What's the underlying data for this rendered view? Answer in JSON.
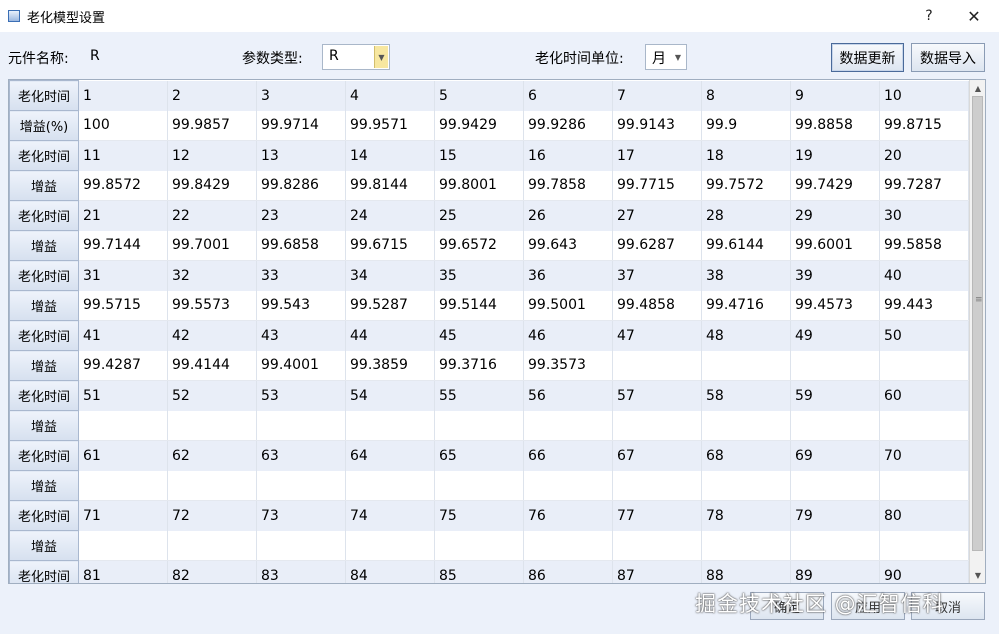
{
  "window": {
    "title": "老化模型设置",
    "help": "?",
    "close": "✕"
  },
  "toolbar": {
    "component_label": "元件名称:",
    "component_value": "R",
    "param_type_label": "参数类型:",
    "param_type_value": "R",
    "time_unit_label": "老化时间单位:",
    "time_unit_value": "月",
    "update_button": "数据更新",
    "import_button": "数据导入"
  },
  "grid": {
    "row_header_time": "老化时间",
    "rows": [
      {
        "time_label": "老化时间",
        "gain_label": "增益(%)",
        "times": [
          "1",
          "2",
          "3",
          "4",
          "5",
          "6",
          "7",
          "8",
          "9",
          "10"
        ],
        "gains": [
          "100",
          "99.9857",
          "99.9714",
          "99.9571",
          "99.9429",
          "99.9286",
          "99.9143",
          "99.9",
          "99.8858",
          "99.8715"
        ]
      },
      {
        "time_label": "老化时间",
        "gain_label": "增益",
        "times": [
          "11",
          "12",
          "13",
          "14",
          "15",
          "16",
          "17",
          "18",
          "19",
          "20"
        ],
        "gains": [
          "99.8572",
          "99.8429",
          "99.8286",
          "99.8144",
          "99.8001",
          "99.7858",
          "99.7715",
          "99.7572",
          "99.7429",
          "99.7287"
        ]
      },
      {
        "time_label": "老化时间",
        "gain_label": "增益",
        "times": [
          "21",
          "22",
          "23",
          "24",
          "25",
          "26",
          "27",
          "28",
          "29",
          "30"
        ],
        "gains": [
          "99.7144",
          "99.7001",
          "99.6858",
          "99.6715",
          "99.6572",
          "99.643",
          "99.6287",
          "99.6144",
          "99.6001",
          "99.5858"
        ]
      },
      {
        "time_label": "老化时间",
        "gain_label": "增益",
        "times": [
          "31",
          "32",
          "33",
          "34",
          "35",
          "36",
          "37",
          "38",
          "39",
          "40"
        ],
        "gains": [
          "99.5715",
          "99.5573",
          "99.543",
          "99.5287",
          "99.5144",
          "99.5001",
          "99.4858",
          "99.4716",
          "99.4573",
          "99.443"
        ]
      },
      {
        "time_label": "老化时间",
        "gain_label": "增益",
        "times": [
          "41",
          "42",
          "43",
          "44",
          "45",
          "46",
          "47",
          "48",
          "49",
          "50"
        ],
        "gains": [
          "99.4287",
          "99.4144",
          "99.4001",
          "99.3859",
          "99.3716",
          "99.3573",
          "",
          "",
          "",
          ""
        ]
      },
      {
        "time_label": "老化时间",
        "gain_label": "增益",
        "times": [
          "51",
          "52",
          "53",
          "54",
          "55",
          "56",
          "57",
          "58",
          "59",
          "60"
        ],
        "gains": [
          "",
          "",
          "",
          "",
          "",
          "",
          "",
          "",
          "",
          ""
        ]
      },
      {
        "time_label": "老化时间",
        "gain_label": "增益",
        "times": [
          "61",
          "62",
          "63",
          "64",
          "65",
          "66",
          "67",
          "68",
          "69",
          "70"
        ],
        "gains": [
          "",
          "",
          "",
          "",
          "",
          "",
          "",
          "",
          "",
          ""
        ]
      },
      {
        "time_label": "老化时间",
        "gain_label": "增益",
        "times": [
          "71",
          "72",
          "73",
          "74",
          "75",
          "76",
          "77",
          "78",
          "79",
          "80"
        ],
        "gains": [
          "",
          "",
          "",
          "",
          "",
          "",
          "",
          "",
          "",
          ""
        ]
      },
      {
        "time_label": "老化时间",
        "gain_label": "",
        "times": [
          "81",
          "82",
          "83",
          "84",
          "85",
          "86",
          "87",
          "88",
          "89",
          "90"
        ],
        "gains": []
      }
    ]
  },
  "footer": {
    "ok_button": "确定",
    "apply_button": "应用",
    "cancel_button": "取消",
    "watermark": "掘金技术社区 @汇智信科"
  }
}
